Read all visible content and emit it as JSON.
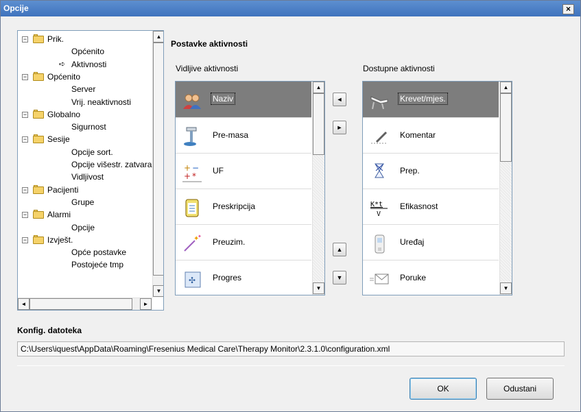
{
  "window": {
    "title": "Opcije",
    "close_label": "×"
  },
  "tree": {
    "nodes": [
      {
        "label": "Prik.",
        "level": 0
      },
      {
        "label": "Općenito",
        "level": 1
      },
      {
        "label": "Aktivnosti",
        "level": 1,
        "current": true
      },
      {
        "label": "Općenito",
        "level": 0
      },
      {
        "label": "Server",
        "level": 1
      },
      {
        "label": "Vrij. neaktivnosti",
        "level": 1
      },
      {
        "label": "Globalno",
        "level": 0
      },
      {
        "label": "Sigurnost",
        "level": 1
      },
      {
        "label": "Sesije",
        "level": 0
      },
      {
        "label": "Opcije sort.",
        "level": 1
      },
      {
        "label": "Opcije višestr. zatvaranja",
        "level": 1
      },
      {
        "label": "Vidljivost",
        "level": 1
      },
      {
        "label": "Pacijenti",
        "level": 0
      },
      {
        "label": "Grupe",
        "level": 1
      },
      {
        "label": "Alarmi",
        "level": 0
      },
      {
        "label": "Opcije",
        "level": 1
      },
      {
        "label": "Izvješt.",
        "level": 0
      },
      {
        "label": "Opće postavke",
        "level": 1
      },
      {
        "label": "Postojeće tmp",
        "level": 1
      }
    ]
  },
  "activities": {
    "section_title": "Postavke aktivnosti",
    "visible_label": "Vidljive aktivnosti",
    "available_label": "Dostupne aktivnosti",
    "visible_items": [
      {
        "label": "Naziv",
        "icon": "people-icon",
        "selected": true
      },
      {
        "label": "Pre-masa",
        "icon": "scale-icon"
      },
      {
        "label": "UF",
        "icon": "uf-icon"
      },
      {
        "label": "Preskripcija",
        "icon": "clipboard-icon"
      },
      {
        "label": "Preuzim.",
        "icon": "magic-wand-icon"
      },
      {
        "label": "Progres",
        "icon": "progress-icon"
      }
    ],
    "available_items": [
      {
        "label": "Krevet/mjes.",
        "icon": "bed-icon",
        "selected": true
      },
      {
        "label": "Komentar",
        "icon": "pencil-icon"
      },
      {
        "label": "Prep.",
        "icon": "hourglass-icon"
      },
      {
        "label": "Efikasnost",
        "icon": "ktv-icon"
      },
      {
        "label": "Uređaj",
        "icon": "machine-icon"
      },
      {
        "label": "Poruke",
        "icon": "envelope-icon"
      }
    ],
    "efficiency_icon_text": {
      "top": "K*t",
      "bottom": "V"
    },
    "move_left_glyph": "◄",
    "move_right_glyph": "►",
    "move_up_glyph": "▲",
    "move_down_glyph": "▼"
  },
  "config": {
    "title": "Konfig. datoteka",
    "path": "C:\\Users\\iquest\\AppData\\Roaming\\Fresenius Medical Care\\Therapy Monitor\\2.3.1.0\\configuration.xml"
  },
  "buttons": {
    "ok": "OK",
    "cancel": "Odustani"
  },
  "scroll_glyphs": {
    "up": "▲",
    "down": "▼",
    "left": "◄",
    "right": "►"
  }
}
